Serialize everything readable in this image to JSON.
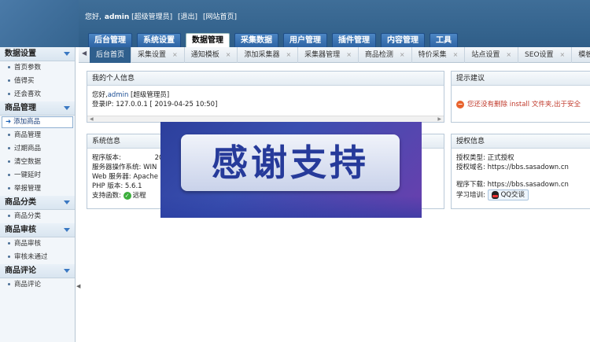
{
  "header": {
    "greeting": "您好,",
    "username": "admin",
    "role": "[超级管理员]",
    "logout": "[退出]",
    "site_home": "[网站首页]"
  },
  "main_nav": [
    {
      "label": "后台管理"
    },
    {
      "label": "系统设置"
    },
    {
      "label": "数据管理"
    },
    {
      "label": "采集数据"
    },
    {
      "label": "用户管理"
    },
    {
      "label": "插件管理"
    },
    {
      "label": "内容管理"
    },
    {
      "label": "工具"
    }
  ],
  "tabs": [
    {
      "label": "后台首页"
    },
    {
      "label": "采集设置"
    },
    {
      "label": "通知模板"
    },
    {
      "label": "添加采集器"
    },
    {
      "label": "采集器管理"
    },
    {
      "label": "商品检测"
    },
    {
      "label": "特价采集"
    },
    {
      "label": "站点设置"
    },
    {
      "label": "SEO设置"
    },
    {
      "label": "模板管理"
    }
  ],
  "tab_close": "×",
  "tab_prev": "◀",
  "sidebar": {
    "groups": [
      {
        "title": "数据设置",
        "items": [
          "首页参数",
          "值得买",
          "还会喜欢"
        ]
      },
      {
        "title": "商品管理",
        "items": [
          "添加商品",
          "商品管理",
          "过期商品",
          "清空数据",
          "一键延时",
          "举报管理"
        ]
      },
      {
        "title": "商品分类",
        "items": [
          "商品分类"
        ]
      },
      {
        "title": "商品审核",
        "items": [
          "商品审核",
          "审核未通过"
        ]
      },
      {
        "title": "商品评论",
        "items": [
          "商品评论"
        ]
      }
    ]
  },
  "personal": {
    "title": "我的个人信息",
    "hello": "您好,",
    "user": "admin",
    "role": "[超级管理员]",
    "login_ip": "登录IP: 127.0.0.1 [ 2019-04-25 10:50]"
  },
  "tips": {
    "title": "提示建议",
    "warning": "您还没有删除 install 文件夹,出于安全"
  },
  "sysinfo": {
    "title": "系统信息",
    "version_label": "程序版本:",
    "version_value": "20",
    "os_label": "服务器操作系统:",
    "os_value": "WIN",
    "web_label": "Web 服务器:",
    "web_value": "Apache",
    "php_label": "PHP 版本:",
    "php_value": "5.6.1",
    "func_label": "支持函数:",
    "func_value": "远程"
  },
  "license": {
    "title": "授权信息",
    "type": "授权类型: 正式授权",
    "domain": "授权域名: https://bbs.sasadown.cn",
    "download": "程序下载: https://bbs.sasadown.cn",
    "learn_label": "学习培训:",
    "qq_label": "QQ交谈"
  },
  "banner": {
    "text": "感谢支持"
  },
  "colors": {
    "header": "#3a6a95",
    "accent_blue": "#1c4e95",
    "warning": "#c0392b"
  }
}
